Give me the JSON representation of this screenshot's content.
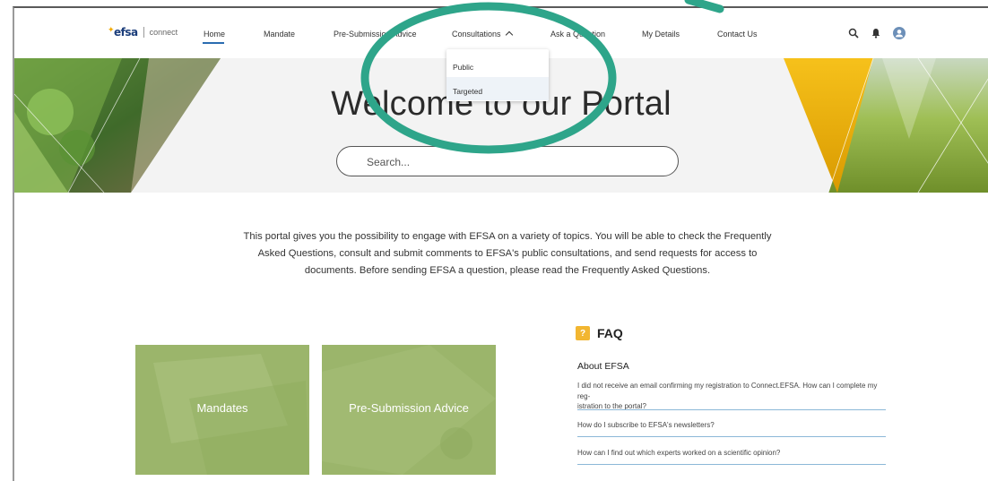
{
  "nav": {
    "logo_text": "efsa",
    "logo_sub": "connect",
    "links": [
      {
        "label": "Home"
      },
      {
        "label": "Mandate"
      },
      {
        "label": "Pre-Submission Advice"
      },
      {
        "label": "Consultations"
      },
      {
        "label": "Ask a Question"
      },
      {
        "label": "My Details"
      },
      {
        "label": "Contact Us"
      }
    ],
    "icons": [
      "search-icon",
      "bell-icon",
      "user-avatar-icon"
    ]
  },
  "dropdown": {
    "items": [
      {
        "label": "Public"
      },
      {
        "label": "Targeted"
      }
    ],
    "selected": "Targeted"
  },
  "hero": {
    "title": "Welcome to our Portal",
    "search_placeholder": "Search..."
  },
  "intro": {
    "line1": "This portal gives you the possibility to engage with EFSA on a variety of topics. You will be able to check the Frequently",
    "line2": "Asked Questions, consult and submit comments to EFSA's public consultations, and send requests for access to",
    "line3": "documents. Before sending EFSA a question, please read the Frequently Asked Questions."
  },
  "tiles": [
    {
      "label": "Mandates"
    },
    {
      "label": "Pre-Submission Advice"
    }
  ],
  "faq": {
    "icon_glyph": "?",
    "title": "FAQ",
    "section": "About EFSA",
    "questions": [
      {
        "line1": "I did not receive an email confirming my registration to Connect.EFSA. How can I complete my reg-",
        "line2": "istration to the portal?"
      },
      {
        "line1": "How do I subscribe to EFSA's newsletters?"
      },
      {
        "line1": "How can I find out which experts worked on a scientific opinion?"
      }
    ]
  },
  "colors": {
    "annotation": "#2ea58a",
    "tile_green": "#9bb56b",
    "accent_blue": "#2a6cb0",
    "faq_icon": "#f2b631"
  }
}
